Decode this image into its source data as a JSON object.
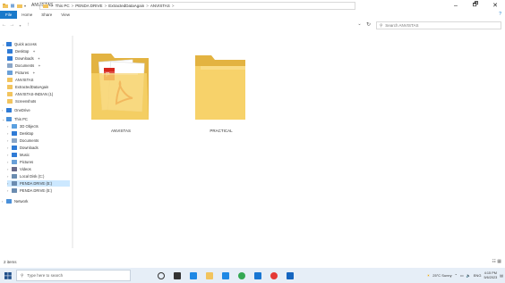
{
  "window": {
    "title": "ANVISTAS",
    "controls": [
      "–",
      "🗗",
      "✕"
    ]
  },
  "ribbon": {
    "file": "File",
    "tabs": [
      "Home",
      "Share",
      "View"
    ],
    "help": "?"
  },
  "address": {
    "crumbs": [
      "This PC",
      "PENDA DRIVE",
      "ExtractedDataAgain",
      "ANVISTAS"
    ],
    "separator": ">",
    "search_placeholder": "Search ANVISTAS"
  },
  "sidebar": {
    "quick_access": "Quick access",
    "quick_items": [
      {
        "label": "Desktop",
        "icon": "desktop-icon",
        "color": "#2f7bd6",
        "pinned": true
      },
      {
        "label": "Downloads",
        "icon": "download-icon",
        "color": "#2f7bd6",
        "pinned": true
      },
      {
        "label": "Documents",
        "icon": "document-icon",
        "color": "#8aa6c8",
        "pinned": true
      },
      {
        "label": "Pictures",
        "icon": "picture-icon",
        "color": "#6aa0d8",
        "pinned": true
      },
      {
        "label": "ANVISTAS",
        "icon": "folder-icon",
        "color": "#f2c45e",
        "pinned": false
      },
      {
        "label": "ExtractedDataAgain",
        "icon": "folder-icon",
        "color": "#f2c45e",
        "pinned": false
      },
      {
        "label": "ANVISTAS-INDIAN (1)",
        "icon": "folder-icon",
        "color": "#f2c45e",
        "pinned": false
      },
      {
        "label": "Screenshots",
        "icon": "folder-icon",
        "color": "#f2c45e",
        "pinned": false
      }
    ],
    "onedrive": "OneDrive",
    "this_pc": "This PC",
    "pc_items": [
      {
        "label": "3D Objects",
        "icon": "cube-icon",
        "color": "#5aa0e0"
      },
      {
        "label": "Desktop",
        "icon": "desktop-icon",
        "color": "#2f7bd6"
      },
      {
        "label": "Documents",
        "icon": "document-icon",
        "color": "#8aa6c8"
      },
      {
        "label": "Downloads",
        "icon": "download-icon",
        "color": "#2f7bd6"
      },
      {
        "label": "Music",
        "icon": "music-icon",
        "color": "#2f7bd6"
      },
      {
        "label": "Pictures",
        "icon": "picture-icon",
        "color": "#6aa0d8"
      },
      {
        "label": "Videos",
        "icon": "video-icon",
        "color": "#6a6a8a"
      },
      {
        "label": "Local Disk (C:)",
        "icon": "drive-icon",
        "color": "#6b8cb0"
      },
      {
        "label": "PENDA DRIVE (E:)",
        "icon": "usb-icon",
        "color": "#6b8cb0",
        "selected": true
      },
      {
        "label": "PENDA DRIVE (E:)",
        "icon": "usb-icon",
        "color": "#6b8cb0"
      }
    ],
    "network": "Network"
  },
  "content": {
    "items": [
      {
        "name": "ANVISTAS",
        "type": "folder-with-pdfs"
      },
      {
        "name": "PRACTICAL",
        "type": "folder-empty"
      }
    ]
  },
  "status": {
    "count": "2 items"
  },
  "taskbar": {
    "search_placeholder": "Type here to search",
    "apps": [
      {
        "icon": "cortana-icon",
        "color": "#333333"
      },
      {
        "icon": "task-view-icon",
        "color": "#333333"
      },
      {
        "icon": "edge-icon",
        "color": "#1e88e5"
      },
      {
        "icon": "file-explorer-icon",
        "color": "#f2c45e"
      },
      {
        "icon": "store-icon",
        "color": "#1e88e5"
      },
      {
        "icon": "chrome-icon",
        "color": "#34a853"
      },
      {
        "icon": "mail-icon",
        "color": "#1976d2"
      },
      {
        "icon": "chrome-profile-icon",
        "color": "#e53935"
      },
      {
        "icon": "photos-icon",
        "color": "#1565c0"
      }
    ],
    "weather": "25°C Sunny",
    "time": "4:15 PM",
    "date": "5/6/2023"
  }
}
